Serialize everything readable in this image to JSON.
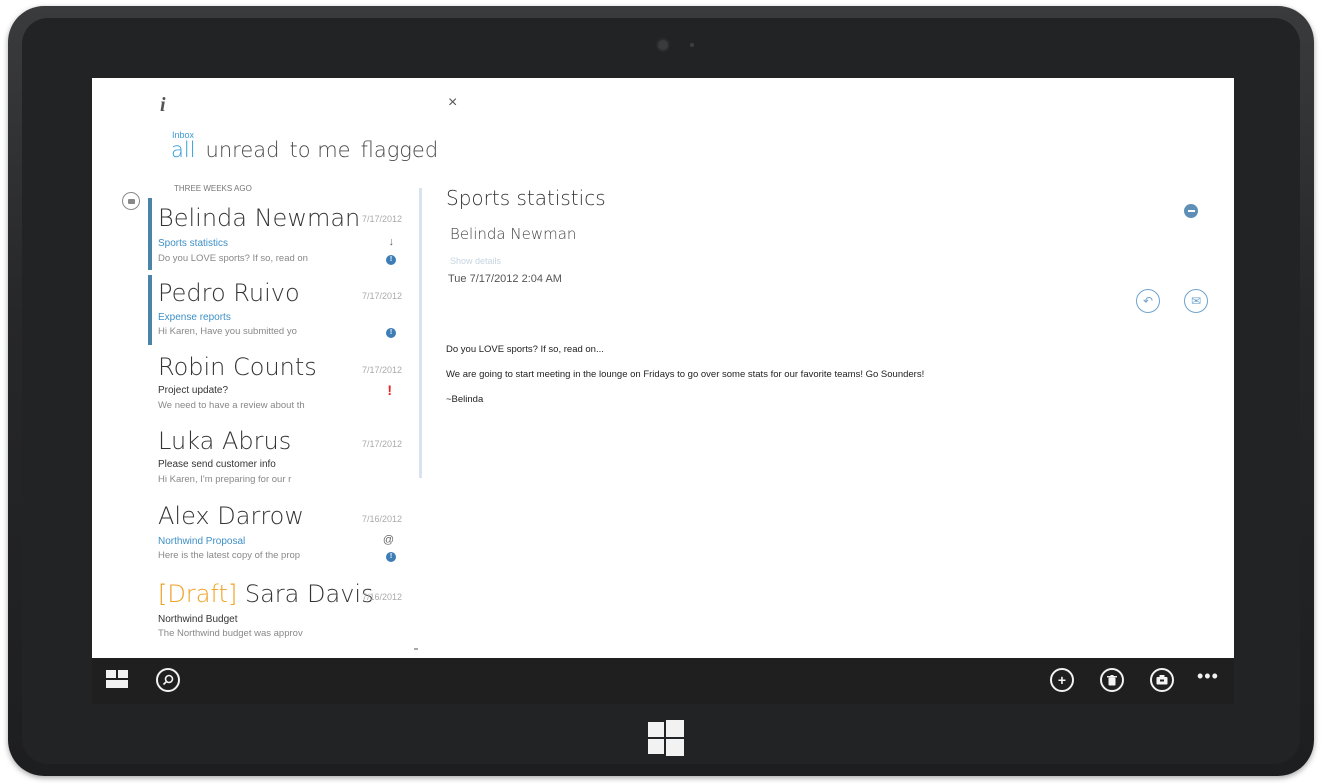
{
  "app": {
    "logo": "i",
    "folder": "Inbox",
    "filters": [
      {
        "label": "all",
        "active": true
      },
      {
        "label": "unread",
        "active": false
      },
      {
        "label": "to me",
        "active": false
      },
      {
        "label": "flagged",
        "active": false
      }
    ],
    "section_header": "THREE WEEKS AGO"
  },
  "messages": [
    {
      "sender": "Belinda Newman",
      "draft": "",
      "date": "7/17/2012",
      "subject": "Sports statistics",
      "preview": "Do you LOVE sports? If so, read on",
      "mark": "↓",
      "badge": "!",
      "selected": true,
      "subject_blue": true
    },
    {
      "sender": "Pedro Ruivo",
      "draft": "",
      "date": "7/17/2012",
      "subject": "Expense reports",
      "preview": "Hi Karen,    Have you submitted yo",
      "mark": "",
      "badge": "!",
      "selected": true,
      "subject_blue": true
    },
    {
      "sender": "Robin Counts",
      "draft": "",
      "date": "7/17/2012",
      "subject": "Project update?",
      "preview": "We need to have a review about th",
      "mark": "!",
      "badge": "",
      "selected": false,
      "subject_blue": false
    },
    {
      "sender": "Luka Abrus",
      "draft": "",
      "date": "7/17/2012",
      "subject": "Please send customer info",
      "preview": "Hi Karen,    I'm preparing for our r",
      "mark": "",
      "badge": "",
      "selected": false,
      "subject_blue": false
    },
    {
      "sender": "Alex Darrow",
      "draft": "",
      "date": "7/16/2012",
      "subject": "Northwind Proposal",
      "preview": "Here is the latest copy of the prop",
      "mark": "@",
      "badge": "!",
      "selected": true,
      "subject_blue": true
    },
    {
      "sender": "Sara Davis",
      "draft": "[Draft]",
      "date": "7/16/2012",
      "subject": "Northwind Budget",
      "preview": "The Northwind budget was approv",
      "mark": "",
      "badge": "",
      "selected": false,
      "subject_blue": false
    }
  ],
  "reading": {
    "close": "×",
    "subject": "Sports statistics",
    "from": "Belinda Newman",
    "details_link": "Show details",
    "date": "Tue 7/17/2012 2:04 AM",
    "body": [
      "Do you LOVE sports?  If so, read on...",
      "We are going to start meeting in the lounge on Fridays to go over some stats for our favorite teams!  Go Sounders!",
      "~Belinda"
    ]
  },
  "app_bar": {
    "more": "•••",
    "icons": [
      "start-icon",
      "search-icon",
      "new-icon",
      "delete-icon",
      "move-icon"
    ]
  },
  "colors": {
    "accent": "#2f9ad8",
    "draft": "#f0a023",
    "flag": "#e22222",
    "app_bar": "#1f1f1f"
  }
}
